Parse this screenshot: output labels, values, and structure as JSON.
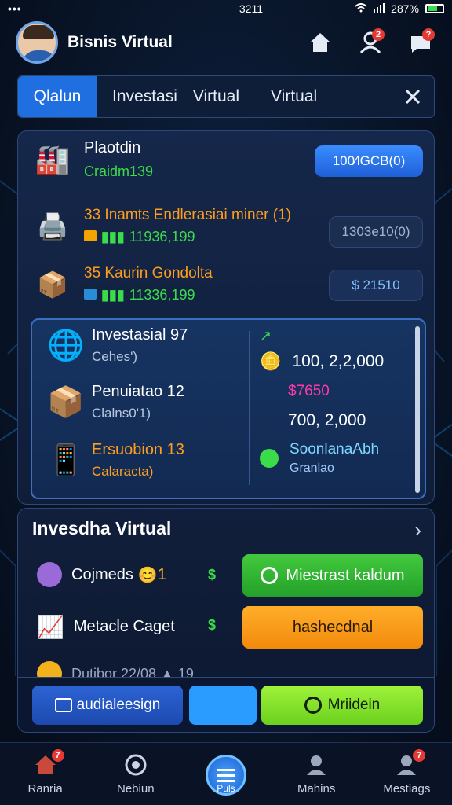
{
  "status_bar": {
    "left": "•••",
    "time": "3211",
    "battery": "287%"
  },
  "header": {
    "title": "Bisnis Virtual",
    "notifications_badge": "2",
    "messages_badge": "?"
  },
  "tabs": [
    {
      "label": "Qlalun"
    },
    {
      "label": "Investasi"
    },
    {
      "label": "Virtual"
    },
    {
      "label": "Virtual"
    }
  ],
  "summary": {
    "name": "Plaotdin",
    "sub": "Craidm139",
    "button": "100∕lGCB(0)"
  },
  "rows": [
    {
      "title": "33 Inamts Endlerasiai miner (1)",
      "value": "11936,199",
      "pill": "1303e10(0)"
    },
    {
      "title": "35 Kaurin Gondolta",
      "value": "11336,199",
      "pill": "$ 21510"
    }
  ],
  "investments": {
    "items": [
      {
        "title": "Investasial 97",
        "sub": "Cehes')"
      },
      {
        "title": "Penuiatao 12",
        "sub": "Clalns0'1)"
      },
      {
        "title": "Ersuobion 13",
        "sub": "Calaracta)"
      }
    ],
    "right": {
      "marker": "↗",
      "amount1": "100, 2,2,000",
      "price": "$7650",
      "amount2": "700, 2,000",
      "link_title": "SoonlanaAbh",
      "link_sub": "Granlao"
    }
  },
  "virtual": {
    "title": "Invesdha Virtual",
    "rows": [
      {
        "label": "Cojmeds",
        "suffix": "1",
        "dollar": "$"
      },
      {
        "label": "Metacle Caget",
        "dollar": "$"
      },
      {
        "label": "Dutibor 22/08 ▲ 19"
      }
    ],
    "green_button": "Miestrast kaldum",
    "orange_button": "hashecdnal",
    "actions": {
      "blue": "audialeesign",
      "lime": "Mriidein"
    }
  },
  "nav": [
    {
      "label": "Ranria",
      "badge": "7"
    },
    {
      "label": "Nebiun"
    },
    {
      "label": "Puls"
    },
    {
      "label": "Mahins"
    },
    {
      "label": "Mestiags",
      "badge": "7"
    }
  ]
}
